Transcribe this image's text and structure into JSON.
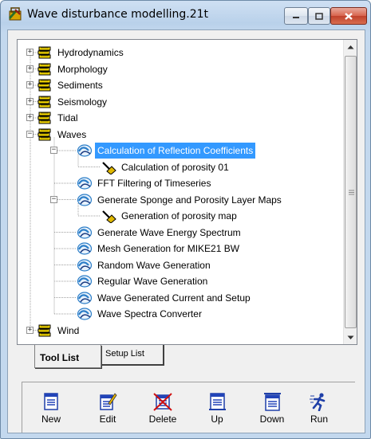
{
  "window": {
    "title": "Wave disturbance modelling.21t",
    "controls": [
      "minimize",
      "maximize",
      "close"
    ]
  },
  "tree": {
    "items": [
      {
        "label": "Hydrodynamics",
        "level": 0,
        "expander": "+",
        "icon": "book-stack-icon"
      },
      {
        "label": "Morphology",
        "level": 0,
        "expander": "+",
        "icon": "book-stack-icon"
      },
      {
        "label": "Sediments",
        "level": 0,
        "expander": "+",
        "icon": "book-stack-icon"
      },
      {
        "label": "Seismology",
        "level": 0,
        "expander": "+",
        "icon": "book-stack-icon"
      },
      {
        "label": "Tidal",
        "level": 0,
        "expander": "+",
        "icon": "book-stack-icon"
      },
      {
        "label": "Waves",
        "level": 0,
        "expander": "-",
        "icon": "book-stack-icon"
      },
      {
        "label": "Calculation of Reflection Coefficients",
        "level": 1,
        "expander": "-",
        "icon": "wave-tool-icon",
        "selected": true
      },
      {
        "label": "Calculation of porosity 01",
        "level": 2,
        "expander": "",
        "icon": "hammer-icon"
      },
      {
        "label": "FFT Filtering of Timeseries",
        "level": 1,
        "expander": "",
        "icon": "wave-tool-icon"
      },
      {
        "label": "Generate Sponge and Porosity Layer Maps",
        "level": 1,
        "expander": "-",
        "icon": "wave-tool-icon"
      },
      {
        "label": "Generation of porosity map",
        "level": 2,
        "expander": "",
        "icon": "hammer-icon"
      },
      {
        "label": "Generate Wave Energy Spectrum",
        "level": 1,
        "expander": "",
        "icon": "wave-tool-icon"
      },
      {
        "label": "Mesh Generation for MIKE21 BW",
        "level": 1,
        "expander": "",
        "icon": "wave-tool-icon"
      },
      {
        "label": "Random Wave Generation",
        "level": 1,
        "expander": "",
        "icon": "wave-tool-icon"
      },
      {
        "label": "Regular Wave Generation",
        "level": 1,
        "expander": "",
        "icon": "wave-tool-icon"
      },
      {
        "label": "Wave Generated Current and Setup",
        "level": 1,
        "expander": "",
        "icon": "wave-tool-icon"
      },
      {
        "label": "Wave Spectra Converter",
        "level": 1,
        "expander": "",
        "icon": "wave-tool-icon"
      },
      {
        "label": "Wind",
        "level": 0,
        "expander": "+",
        "icon": "book-stack-icon"
      }
    ]
  },
  "tabs": {
    "tool_list": "Tool List",
    "setup_list": "Setup List"
  },
  "toolbar": {
    "new": "New",
    "edit": "Edit",
    "delete": "Delete",
    "up": "Up",
    "down": "Down",
    "run": "Run"
  },
  "colors": {
    "selection": "#3399ff",
    "book_yellow": "#f5d800",
    "wave_blue": "#2c7ec8",
    "close_red": "#c7462f"
  }
}
